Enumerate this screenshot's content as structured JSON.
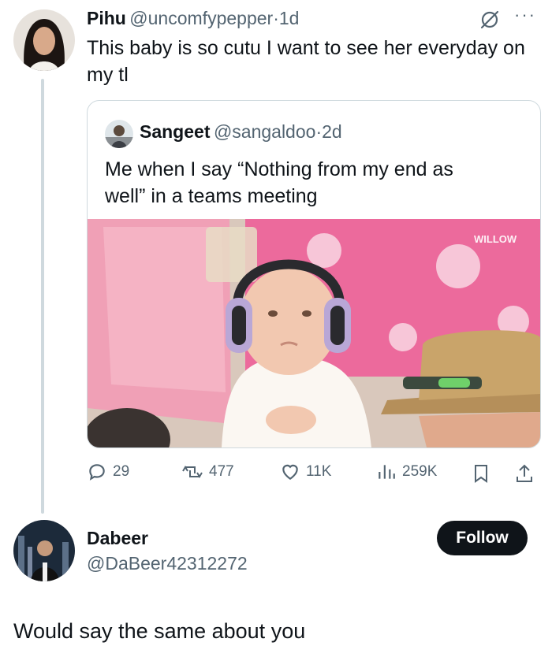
{
  "original_tweet": {
    "author_name": "Pihu",
    "author_handle": "@uncomfypepper",
    "time": "1d",
    "text": "This baby is so cutu I want to see her everyday on my tl",
    "quoted_tweet": {
      "author_name": "Sangeet",
      "author_handle": "@sangaldoo",
      "time": "2d",
      "text": "Me when I say “Nothing from my end as well” in a teams meeting",
      "image_watermark": "WILLOW"
    },
    "stats": {
      "replies": "29",
      "reposts": "477",
      "likes": "11K",
      "views": "259K"
    }
  },
  "reply": {
    "author_name": "Dabeer",
    "author_handle": "@DaBeer42312272",
    "follow_label": "Follow",
    "text": "Would say the same about you"
  },
  "colors": {
    "text": "#0f1419",
    "secondary": "#536471",
    "border": "#cfd9de",
    "pink_shirt": "#f2a3b7",
    "floral_pink": "#e8508f"
  },
  "icons": [
    "grok-slash-icon",
    "more-icon",
    "reply-icon",
    "repost-icon",
    "like-icon",
    "views-icon",
    "bookmark-icon",
    "share-icon"
  ]
}
